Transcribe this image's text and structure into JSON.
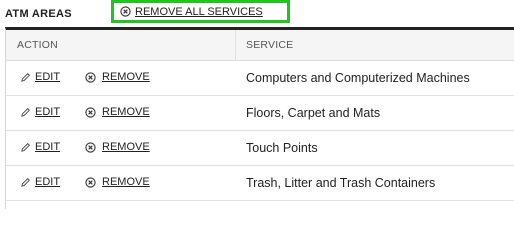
{
  "section": {
    "title": "ATM AREAS",
    "remove_all_label": "REMOVE ALL SERVICES"
  },
  "table": {
    "headers": {
      "action": "ACTION",
      "service": "SERVICE"
    },
    "rows": [
      {
        "edit_label": "EDIT",
        "remove_label": "REMOVE",
        "service": "Computers and Computerized Machines"
      },
      {
        "edit_label": "EDIT",
        "remove_label": "REMOVE",
        "service": "Floors, Carpet and Mats"
      },
      {
        "edit_label": "EDIT",
        "remove_label": "REMOVE",
        "service": "Touch Points"
      },
      {
        "edit_label": "EDIT",
        "remove_label": "REMOVE",
        "service": "Trash, Litter and Trash Containers"
      }
    ]
  },
  "icons": {
    "edit": "pencil-icon",
    "remove": "close-circle-icon"
  },
  "colors": {
    "highlight_border": "#22c322",
    "table_top_border": "#222222"
  }
}
